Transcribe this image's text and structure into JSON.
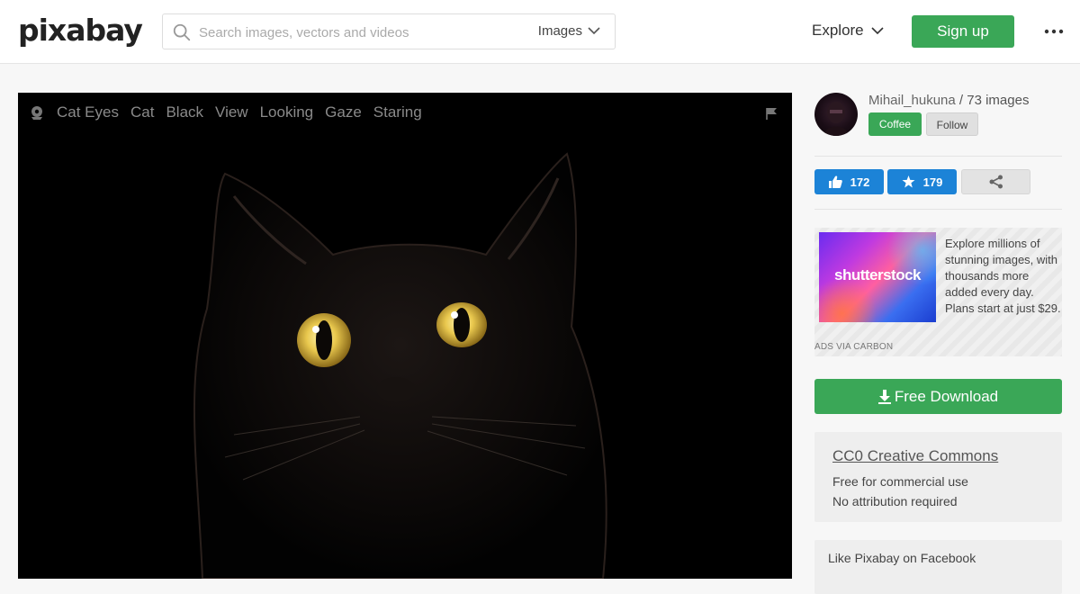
{
  "header": {
    "logo_text": "pixabay",
    "search": {
      "placeholder": "Search images, vectors and videos",
      "type_label": "Images"
    },
    "explore_label": "Explore",
    "signup_label": "Sign up"
  },
  "photo": {
    "tags": [
      "Cat Eyes",
      "Cat",
      "Black",
      "View",
      "Looking",
      "Gaze",
      "Staring"
    ]
  },
  "author": {
    "name": "Mihail_hukuna",
    "separator": " / ",
    "images_count": "73 images",
    "coffee_label": "Coffee",
    "follow_label": "Follow"
  },
  "stats": {
    "likes": "172",
    "favorites": "179"
  },
  "ad": {
    "brand": "shutterstock",
    "text": "Explore millions of stunning images, with thousands more added every day. Plans start at just $29.",
    "via": "ADS VIA CARBON"
  },
  "download_label": "Free Download",
  "license": {
    "title": "CC0 Creative Commons",
    "line1": "Free for commercial use",
    "line2": "No attribution required"
  },
  "facebook_label": "Like Pixabay on Facebook",
  "colors": {
    "green": "#3aa757",
    "blue": "#1c83d7"
  }
}
